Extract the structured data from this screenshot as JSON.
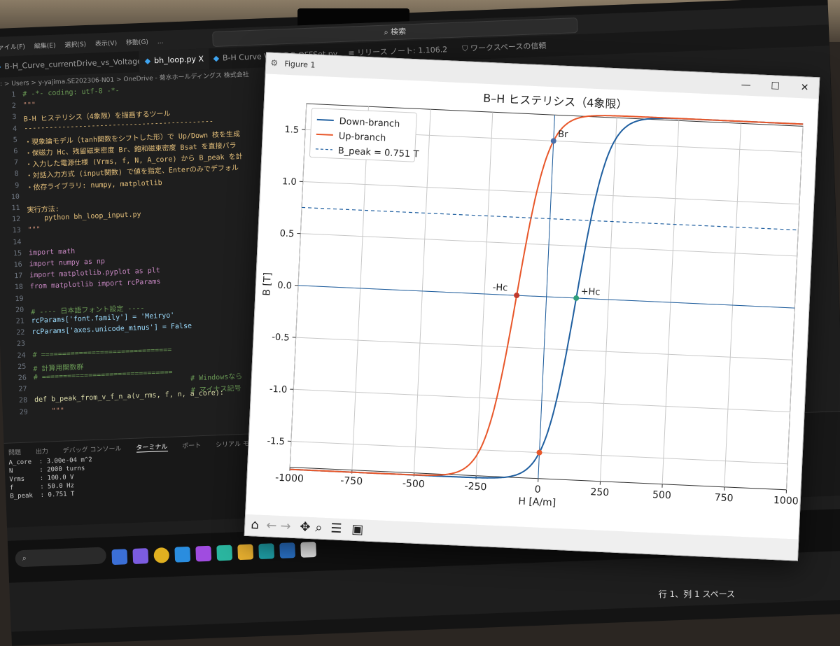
{
  "ide": {
    "menus": [
      "ファイル(F)",
      "編集(E)",
      "選択(S)",
      "表示(V)",
      "移動(G)",
      "..."
    ],
    "search_label": "検索",
    "tabs": [
      {
        "label": "B-H_Curve_currentDrive_vs_VoltageDrive.py",
        "active": false
      },
      {
        "label": "bh_loop.py",
        "active": true,
        "close": "X"
      },
      {
        "label": "B-H Curve With DC-OFFSet.py",
        "active": false
      },
      {
        "label": "リリース ノート: 1.106.2",
        "active": false
      },
      {
        "label": "ワークスペースの信頼",
        "active": false
      }
    ],
    "breadcrumb": "C: > Users > y-yajima.SE202306-N01 > OneDrive - 菊水ホールディングス 株式会社",
    "code_lines": [
      {
        "n": "1",
        "t": "# -*- coding: utf-8 -*-",
        "c": "#6a9955"
      },
      {
        "n": "2",
        "t": "\"\"\"",
        "c": "#ce9178"
      },
      {
        "n": "3",
        "t": "B-H ヒステリシス（4象限）を描画するツール",
        "c": "#e5c07b"
      },
      {
        "n": "4",
        "t": "---------------------------------------------",
        "c": "#e5c07b"
      },
      {
        "n": "5",
        "t": "・現象論モデル（tanh関数をシフトした形）で Up/Down 枝を生成",
        "c": "#e5c07b"
      },
      {
        "n": "6",
        "t": "・保磁力 Hc、残留磁束密度 Br、飽和磁束密度 Bsat を直接パラ",
        "c": "#e5c07b"
      },
      {
        "n": "7",
        "t": "・入力した電源仕様 (Vrms, f, N, A_core) から B_peak を計",
        "c": "#e5c07b"
      },
      {
        "n": "8",
        "t": "・対話入力方式 (input関数) で値を指定、Enterのみでデフォル",
        "c": "#e5c07b"
      },
      {
        "n": "9",
        "t": "・依存ライブラリ: numpy, matplotlib",
        "c": "#e5c07b"
      },
      {
        "n": "10",
        "t": "",
        "c": "#ccc"
      },
      {
        "n": "11",
        "t": "実行方法:",
        "c": "#e5c07b"
      },
      {
        "n": "12",
        "t": "    python bh_loop_input.py",
        "c": "#e5c07b"
      },
      {
        "n": "13",
        "t": "\"\"\"",
        "c": "#ce9178"
      },
      {
        "n": "14",
        "t": "",
        "c": "#ccc"
      },
      {
        "n": "15",
        "t": "import math",
        "c": "#c586c0"
      },
      {
        "n": "16",
        "t": "import numpy as np",
        "c": "#c586c0"
      },
      {
        "n": "17",
        "t": "import matplotlib.pyplot as plt",
        "c": "#c586c0"
      },
      {
        "n": "18",
        "t": "from matplotlib import rcParams",
        "c": "#c586c0"
      },
      {
        "n": "19",
        "t": "",
        "c": "#ccc"
      },
      {
        "n": "20",
        "t": "# ---- 日本語フォント設定 ----",
        "c": "#6a9955"
      },
      {
        "n": "21",
        "t": "rcParams['font.family'] = 'Meiryo'",
        "c": "#9cdcfe"
      },
      {
        "n": "22",
        "t": "rcParams['axes.unicode_minus'] = False",
        "c": "#9cdcfe"
      },
      {
        "n": "23",
        "t": "",
        "c": "#ccc"
      },
      {
        "n": "24",
        "t": "# ===============================",
        "c": "#6a9955"
      },
      {
        "n": "25",
        "t": "# 計算用関数群",
        "c": "#6a9955"
      },
      {
        "n": "26",
        "t": "# ===============================",
        "c": "#6a9955"
      },
      {
        "n": "27",
        "t": "",
        "c": "#ccc"
      },
      {
        "n": "28",
        "t": "def b_peak_from_v_f_n_a(v_rms, f, n, a_core):",
        "c": "#dcdcaa"
      },
      {
        "n": "29",
        "t": "    \"\"\"",
        "c": "#ce9178"
      }
    ],
    "comments": [
      "# Windowsなら",
      "# マイナス記号"
    ],
    "panel_tabs": [
      "問題",
      "出力",
      "デバッグ コンソール",
      "ターミナル",
      "ポート",
      "シリアル モニター"
    ],
    "terminal_lines": [
      "A_core  : 3.00e-04 m^2",
      "N       : 2000 turns",
      "Vrms    : 100.0 V",
      "f       : 50.0 Hz",
      "B_peak  : 0.751 T"
    ],
    "status_text": "行 1、列 1   スペース"
  },
  "figure": {
    "window_title": "Figure 1",
    "minimize_label": "—",
    "maximize_label": "☐",
    "close_label": "✕",
    "toolbar": [
      "home-icon",
      "back-icon",
      "forward-icon",
      "pan-icon",
      "zoom-icon",
      "configure-icon",
      "save-icon"
    ]
  },
  "chart_data": {
    "type": "line",
    "title": "B–H ヒステリシス（4象限）",
    "xlabel": "H [A/m]",
    "ylabel": "B [T]",
    "xlim": [
      -1000,
      1000
    ],
    "ylim": [
      -1.75,
      1.75
    ],
    "xticks": [
      -1000,
      -750,
      -500,
      -250,
      0,
      250,
      500,
      750,
      1000
    ],
    "yticks": [
      -1.5,
      -1.0,
      -0.5,
      0.0,
      0.5,
      1.0,
      1.5
    ],
    "ytick_labels": [
      "-1.5",
      "-1.0",
      "-0.5",
      "0.0",
      "0.5",
      "1.0",
      "1.5"
    ],
    "grid": true,
    "legend_position": "upper-left",
    "series": [
      {
        "name": "Down-branch",
        "color": "#1f5fa0",
        "Hc": 120,
        "Bsat": 1.77,
        "Br": 1.5
      },
      {
        "name": "Up-branch",
        "color": "#e8572a",
        "Hc": -120,
        "Bsat": 1.77,
        "Br": -1.5
      },
      {
        "name": "B_peak = 0.751 T",
        "color": "#1f5fa0",
        "dashed": true,
        "y": 0.751
      }
    ],
    "annotations": [
      {
        "label": "Br",
        "x": 0,
        "y": 1.5,
        "color": "#4a6ea8"
      },
      {
        "label": "-Hc",
        "x": -120,
        "y": 0.0,
        "color": "#c0392b"
      },
      {
        "label": "+Hc",
        "x": 120,
        "y": 0.0,
        "color": "#2e9e7a"
      },
      {
        "label": "",
        "x": 0,
        "y": -1.5,
        "color": "#e8572a"
      }
    ]
  }
}
